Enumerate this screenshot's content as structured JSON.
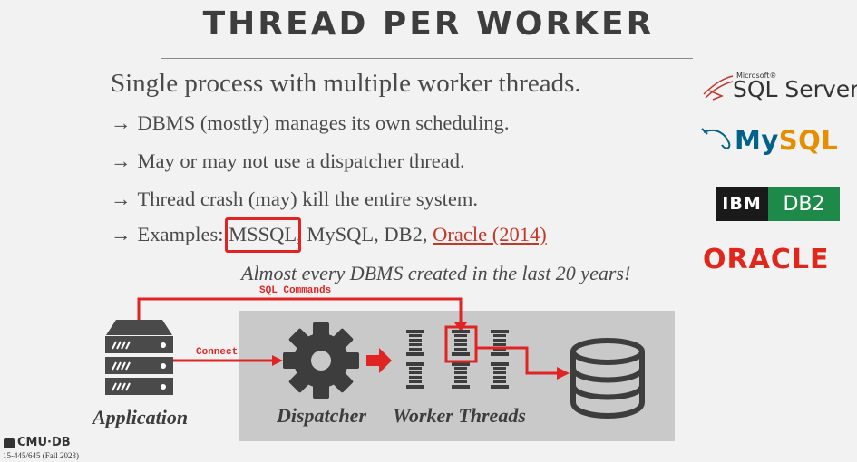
{
  "title": "THREAD PER WORKER",
  "headline": "Single process with multiple worker threads.",
  "bullets": {
    "arrow": "→",
    "b1": "DBMS (mostly) manages its own scheduling.",
    "b2": "May or may not use a dispatcher thread.",
    "b3": "Thread crash (may) kill the entire system.",
    "b4_prefix": "Examples: ",
    "b4_mssql": "MSSQL",
    "b4_middle": ", MySQL, DB2, ",
    "b4_oracle": "Oracle (2014)"
  },
  "note": "Almost every DBMS created in the last 20 years!",
  "logos": {
    "sql_server_small": "Microsoft®",
    "sql_server": "SQL Server",
    "mysql_my": "My",
    "mysql_sql": "SQL",
    "ibm": "IBM",
    "db2": "DB2",
    "oracle": "ORACLE"
  },
  "diagram": {
    "application": "Application",
    "dispatcher": "Dispatcher",
    "worker_threads": "Worker Threads",
    "sql_commands": "SQL Commands",
    "connect": "Connect"
  },
  "footer": {
    "org": "CMU·DB",
    "course": "15-445/645 (Fall 2023)"
  },
  "colors": {
    "highlight": "#e02424",
    "link": "#c0392b",
    "panel": "#c9c9c9"
  }
}
